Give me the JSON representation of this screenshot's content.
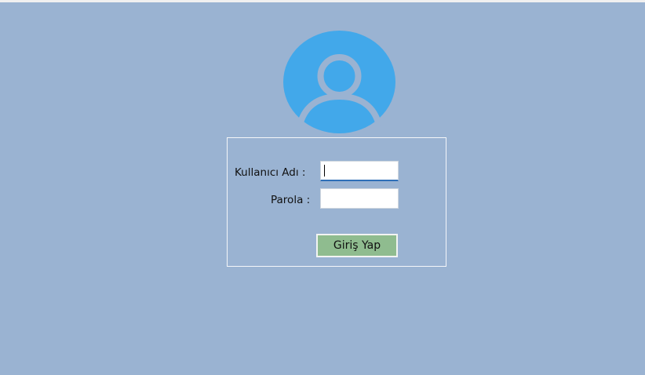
{
  "login": {
    "username_label": "Kullanıcı Adı :",
    "password_label": "Parola :",
    "username_value": "",
    "password_value": "",
    "submit_label": "Giriş Yap"
  },
  "avatar": {
    "icon": "user-profile-icon",
    "color": "#42a8ea"
  },
  "colors": {
    "background": "#9ab3d2",
    "button": "#8fbc8f"
  }
}
